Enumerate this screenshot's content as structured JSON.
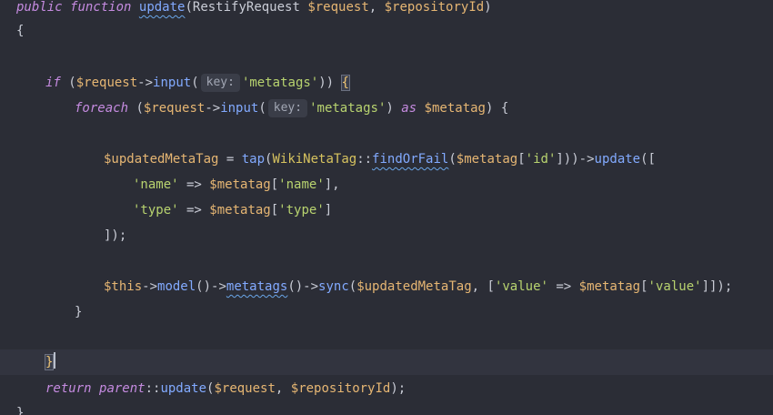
{
  "code": {
    "l1": {
      "kw1": "public",
      "kw2": "function",
      "fn": "update",
      "open": "(RestifyRequest ",
      "v1": "$request",
      "comma": ", ",
      "v2": "$repositoryId",
      "close": ")"
    },
    "l2": "{",
    "l3": {
      "kw": "if",
      "p1": "(",
      "v": "$request",
      "arrow": "->",
      "fn": "input",
      "p2": "(",
      "hint": "key:",
      "str": "'metatags'",
      "p3": "))",
      "brace": "{"
    },
    "l4": {
      "kw": "foreach",
      "p1": "(",
      "v": "$request",
      "arrow": "->",
      "fn": "input",
      "p2": "(",
      "hint": "key:",
      "str": "'metatags'",
      "p3": ") ",
      "as": "as",
      "v2": "$metatag",
      "p4": ") {"
    },
    "l5": {
      "v": "$updatedMetaTag",
      "eq": " = ",
      "fn1": "tap",
      "p1": "(",
      "cls": "WikiNetaTag",
      "dc": "::",
      "fn2": "findOrFail",
      "p2": "(",
      "v2": "$metatag",
      "b1": "[",
      "str": "'id'",
      "b2": "]))->",
      "fn3": "update",
      "p3": "(["
    },
    "l6": {
      "str1": "'name'",
      "arr": " => ",
      "v": "$metatag",
      "b1": "[",
      "str2": "'name'",
      "b2": "],"
    },
    "l7": {
      "str1": "'type'",
      "arr": " => ",
      "v": "$metatag",
      "b1": "[",
      "str2": "'type'",
      "b2": "]"
    },
    "l8": "]);",
    "l9": {
      "v": "$this",
      "a1": "->",
      "fn1": "model",
      "p1": "()->",
      "fn2": "metatags",
      "p2": "()->",
      "fn3": "sync",
      "p3": "(",
      "v2": "$updatedMetaTag",
      "p4": ", [",
      "str1": "'value'",
      "arr": " => ",
      "v3": "$metatag",
      "b1": "[",
      "str2": "'value'",
      "b2": "]]);"
    },
    "l10": "}",
    "l11": "}",
    "l12": {
      "kw1": "return",
      "kw2": "parent",
      "dc": "::",
      "fn": "update",
      "p1": "(",
      "v1": "$request",
      "comma": ", ",
      "v2": "$repositoryId",
      "p2": ");"
    },
    "l13": "}"
  }
}
